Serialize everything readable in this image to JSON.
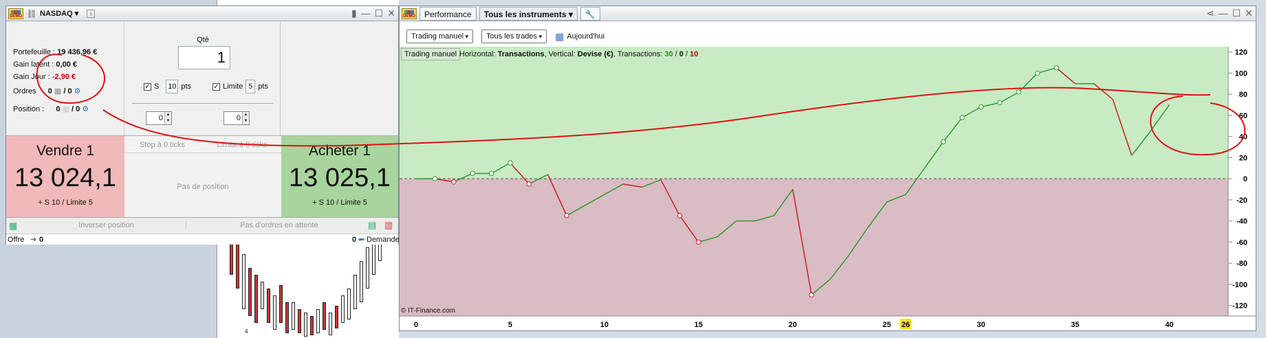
{
  "order_panel": {
    "instrument": "NASDAQ",
    "info_glyph": "i",
    "portfolio_label": "Portefeuille :",
    "portfolio_value": "19 436,96 €",
    "unrealized_label": "Gain latent :",
    "unrealized_value": "0,00 €",
    "day_gain_label": "Gain Jour :",
    "day_gain_value": "-2,90 €",
    "orders_label": "Ordres",
    "orders_a": "0",
    "orders_b": "/ 0",
    "position_label": "Position :",
    "position_a": "0",
    "position_b": "/ 0",
    "qty_label": "Qté",
    "qty_value": "1",
    "stop_label": "S",
    "stop_value": "10",
    "stop_unit": "pts",
    "limit_label": "Limite",
    "limit_value": "5",
    "limit_unit": "pts",
    "spin_left_value": "0",
    "spin_right_value": "0",
    "stop_ticks_label": "Stop à 0 ticks",
    "limit_ticks_label": "Limite à 0 ticks",
    "sell_title": "Vendre 1",
    "sell_price": "13 024,1",
    "sell_sub": "+ S 10 / Limite 5",
    "buy_title": "Acheter 1",
    "buy_price": "13 025,1",
    "buy_sub": "+ S 10 / Limite 5",
    "no_position": "Pas de position",
    "reverse_position": "Inverser position",
    "no_pending_orders": "Pas d'ordres en attente",
    "bid_label": "Offre",
    "bid_value": "0",
    "ask_value": "0",
    "ask_label": "Demande"
  },
  "left_bg_chart": {
    "tick_label": "4"
  },
  "performance_window": {
    "tab_performance": "Performance",
    "tab_instruments": "Tous les instruments",
    "filter_mode": "Trading manuel",
    "filter_trades": "Tous les trades",
    "date_label": "Aujourd'hui",
    "chart_tab": "Trading manuel",
    "legend_prefix": "Horizontal: ",
    "legend_h": "Transactions",
    "legend_mid": ", Vertical: ",
    "legend_v": "Devise (€)",
    "legend_tx": ", Transactions: ",
    "tx_total": "30",
    "tx_sep1": " / ",
    "tx_zero": "0",
    "tx_sep2": " / ",
    "tx_losses": "10",
    "copyright": "© IT-Finance.com",
    "highlight_x": "26"
  },
  "colors": {
    "profit_zone": "#c8ebc4",
    "loss_zone": "#d9bcc4",
    "gain_line": "#2e9a2e",
    "loss_line": "#c82020",
    "annotation": "#e01010"
  },
  "chart_data": {
    "type": "line",
    "xlabel": "Transactions",
    "ylabel": "Devise (€)",
    "xlim": [
      0,
      44
    ],
    "ylim": [
      -130,
      125
    ],
    "x_ticks": [
      0,
      5,
      10,
      15,
      20,
      25,
      30,
      35,
      40
    ],
    "y_ticks": [
      120,
      100,
      80,
      60,
      40,
      20,
      0,
      -20,
      -40,
      -60,
      -80,
      -100,
      -120
    ],
    "highlighted_x": 26,
    "points": [
      [
        0,
        0
      ],
      [
        1,
        0
      ],
      [
        2,
        -3
      ],
      [
        3,
        5
      ],
      [
        4,
        5
      ],
      [
        5,
        15
      ],
      [
        6,
        -5
      ],
      [
        7,
        4
      ],
      [
        8,
        -35
      ],
      [
        9,
        -25
      ],
      [
        10,
        -15
      ],
      [
        11,
        -5
      ],
      [
        12,
        -8
      ],
      [
        13,
        -1
      ],
      [
        14,
        -35
      ],
      [
        15,
        -60
      ],
      [
        16,
        -55
      ],
      [
        17,
        -40
      ],
      [
        18,
        -40
      ],
      [
        19,
        -35
      ],
      [
        20,
        -10
      ],
      [
        21,
        -110
      ],
      [
        22,
        -95
      ],
      [
        23,
        -72
      ],
      [
        24,
        -46
      ],
      [
        25,
        -22
      ],
      [
        26,
        -15
      ],
      [
        27,
        10
      ],
      [
        28,
        35
      ],
      [
        29,
        58
      ],
      [
        30,
        68
      ],
      [
        31,
        72
      ],
      [
        32,
        82
      ],
      [
        33,
        100
      ],
      [
        34,
        105
      ],
      [
        35,
        90
      ],
      [
        36,
        90
      ],
      [
        37,
        75
      ],
      [
        38,
        22
      ],
      [
        39,
        45
      ],
      [
        40,
        70
      ]
    ]
  }
}
